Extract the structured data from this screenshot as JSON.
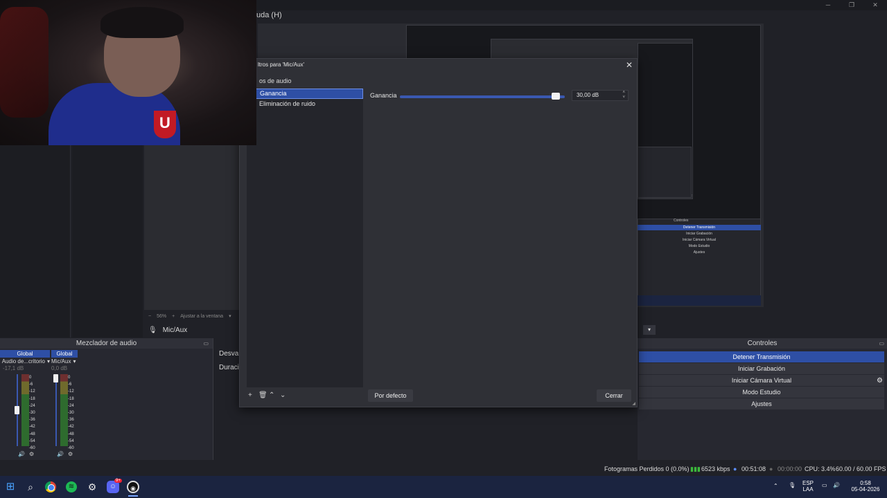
{
  "window": {
    "menu_item": "uda (H)"
  },
  "filters_dialog": {
    "title": "ltros para 'Mic/Aux'",
    "section_label": "os de audio",
    "filters": [
      "Ganancia",
      "Eliminación de ruido"
    ],
    "selected_filter": "Ganancia",
    "property_label": "Ganancia",
    "gain_value": "30,00 dB",
    "gain_fraction": 0.97,
    "default_button": "Por defecto",
    "close_button": "Cerrar"
  },
  "preview": {
    "zoom": "56%",
    "fit_label": "Ajustar a la ventana",
    "source_name": "Mic/Aux"
  },
  "mixer": {
    "title": "Mezclador de audio",
    "channels": [
      {
        "label": "Global",
        "name": "Audio de...critorio",
        "db": "-17,1 dB"
      },
      {
        "label": "Global",
        "name": "Mic/Aux",
        "db": "0,0 dB"
      }
    ],
    "scale": [
      "0",
      "-6",
      "-12",
      "-18",
      "-24",
      "-30",
      "-36",
      "-42",
      "-48",
      "-54",
      "-60"
    ]
  },
  "transitions": {
    "row1": "Desvan",
    "row2": "Duración"
  },
  "controls": {
    "title": "Controles",
    "buttons": [
      "Detener Transmisión",
      "Iniciar Grabación",
      "Iniciar Cámara Virtual",
      "Modo Estudio",
      "Ajustes"
    ]
  },
  "status": {
    "dropped": "Fotogramas Perdidos 0 (0.0%)",
    "bitrate": "6523 kbps",
    "stream_time": "00:51:08",
    "rec_time": "00:00:00",
    "cpu": "CPU: 3.4%",
    "fps": "60.00 / 60.00 FPS"
  },
  "taskbar": {
    "lang_top": "ESP",
    "lang_bottom": "LAA",
    "time": "0:58",
    "date": "05-04-2026",
    "discord_badge": "9+"
  },
  "colors": {
    "accent": "#2e4fa5",
    "dialog_bg": "#2f3036",
    "taskbar": "#1b2440"
  }
}
